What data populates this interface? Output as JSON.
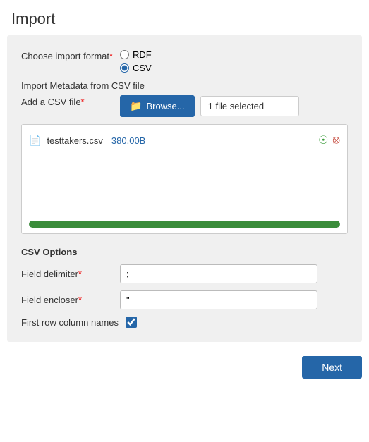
{
  "page": {
    "title": "Import"
  },
  "form": {
    "choose_format_label": "Choose import format",
    "required_star": "*",
    "rdf_label": "RDF",
    "csv_label": "CSV",
    "metadata_label": "Import Metadata from CSV file",
    "add_csv_label": "Add a CSV file",
    "browse_label": "Browse...",
    "file_selected_text": "1 file selected",
    "file_name": "testtakers.csv",
    "file_size": "380.00B",
    "progress_percent": 100,
    "csv_options_title": "CSV Options",
    "field_delimiter_label": "Field delimiter",
    "field_encloser_label": "Field encloser",
    "first_row_label": "First row column names",
    "field_delimiter_value": ";",
    "field_encloser_value": "\""
  },
  "footer": {
    "next_label": "Next"
  },
  "icons": {
    "folder": "📁",
    "file": "📄",
    "check": "✔",
    "close": "✖"
  }
}
